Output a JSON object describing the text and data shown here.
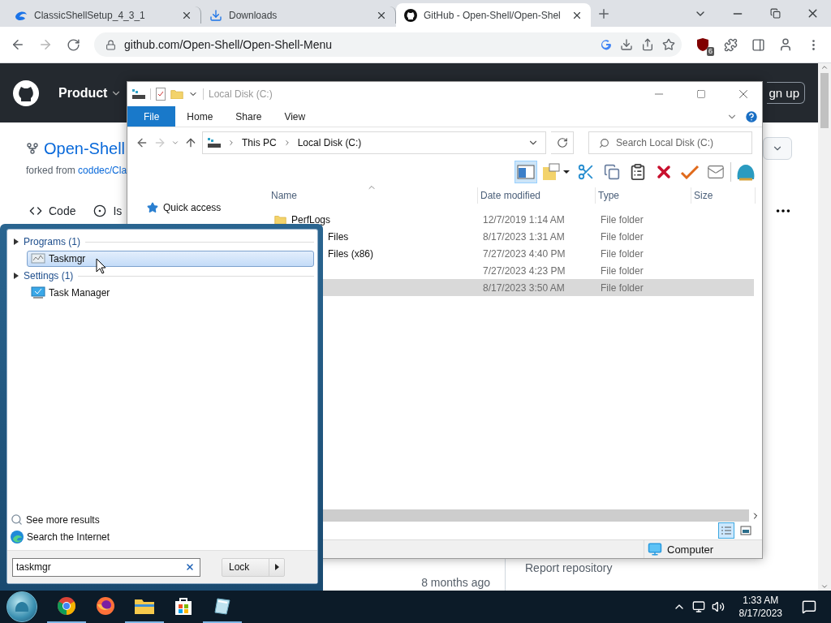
{
  "browser": {
    "tabs": [
      {
        "title": "ClassicShellSetup_4_3_1",
        "selected": false
      },
      {
        "title": "Downloads",
        "selected": false
      },
      {
        "title": "GitHub - Open-Shell/Open-Shel",
        "selected": true
      }
    ],
    "url": "github.com/Open-Shell/Open-Shell-Menu",
    "extension_badge": "6"
  },
  "web_page": {
    "menu": "Product",
    "sign_up": "gn up",
    "repo_name": "Open-Shell",
    "forked_from": "forked from",
    "forked_link": "coddec/Cla",
    "tabs": [
      {
        "label": "Code"
      },
      {
        "label": "Is"
      }
    ],
    "report": "Report repository",
    "updated": "8 months ago"
  },
  "explorer": {
    "title": "Local Disk (C:)",
    "ribbon_tabs": [
      {
        "label": "File",
        "selected": true
      },
      {
        "label": "Home",
        "selected": false
      },
      {
        "label": "Share",
        "selected": false
      },
      {
        "label": "View",
        "selected": false
      }
    ],
    "breadcrumb": [
      "This PC",
      "Local Disk (C:)"
    ],
    "search_placeholder": "Search Local Disk (C:)",
    "preview_pane_on": true,
    "nav": [
      "Quick access"
    ],
    "columns": [
      "Name",
      "Date modified",
      "Type",
      "Size"
    ],
    "rows": [
      {
        "name": "PerfLogs",
        "covered": false,
        "date": "12/7/2019 1:14 AM",
        "type": "File folder",
        "selected": false
      },
      {
        "name": "Files",
        "covered": true,
        "date": "8/17/2023 1:31 AM",
        "type": "File folder",
        "selected": false
      },
      {
        "name": "Files (x86)",
        "covered": true,
        "date": "7/27/2023 4:40 PM",
        "type": "File folder",
        "selected": false
      },
      {
        "date": "7/27/2023 4:23 PM",
        "type": "File folder",
        "selected": false
      },
      {
        "date": "8/17/2023 3:50 AM",
        "type": "File folder",
        "selected": true
      }
    ],
    "details_view": true,
    "status": "Computer"
  },
  "start_menu": {
    "groups": [
      {
        "label": "Programs (1)",
        "items": [
          {
            "label": "Taskmgr",
            "selected": true
          }
        ]
      },
      {
        "label": "Settings (1)",
        "items": [
          {
            "label": "Task Manager",
            "selected": false
          }
        ]
      }
    ],
    "links": [
      {
        "kind": "search",
        "label": "See more results"
      },
      {
        "kind": "web",
        "label": "Search the Internet"
      }
    ],
    "search_value": "taskmgr",
    "power_button": "Lock"
  },
  "taskbar": {
    "apps": [
      {
        "kind": "chrome",
        "running": true
      },
      {
        "kind": "firefox",
        "running": false
      },
      {
        "kind": "folder",
        "running": true
      },
      {
        "kind": "store",
        "running": false
      },
      {
        "kind": "notes",
        "running": true
      }
    ],
    "time": "1:33 AM",
    "date": "8/17/2023"
  }
}
